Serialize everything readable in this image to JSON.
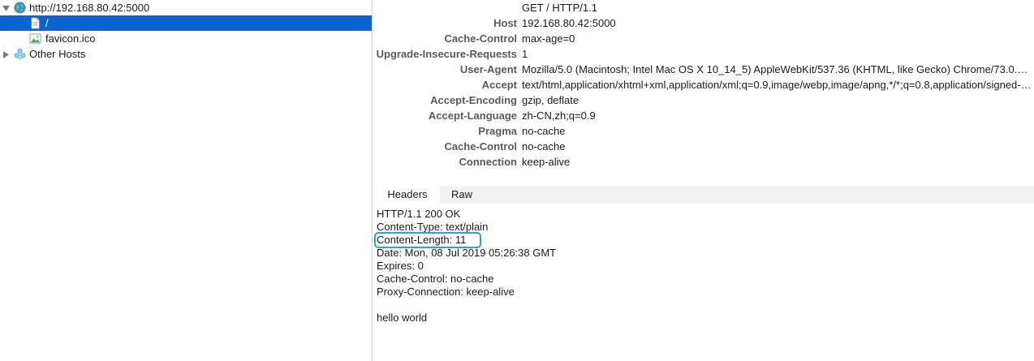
{
  "tree": {
    "host": {
      "label": "http://192.168.80.42:5000",
      "icon": "globe-icon",
      "expanded": true
    },
    "children": [
      {
        "label": "/",
        "icon": "document-icon",
        "selected": true
      },
      {
        "label": "favicon.ico",
        "icon": "image-icon",
        "selected": false
      }
    ],
    "other_hosts": {
      "label": "Other Hosts",
      "icon": "cluster-icon",
      "expanded": false
    }
  },
  "request": {
    "first_line": "GET / HTTP/1.1",
    "headers": [
      {
        "key": "Host",
        "value": "192.168.80.42:5000"
      },
      {
        "key": "Cache-Control",
        "value": "max-age=0"
      },
      {
        "key": "Upgrade-Insecure-Requests",
        "value": "1"
      },
      {
        "key": "User-Agent",
        "value": "Mozilla/5.0 (Macintosh; Intel Mac OS X 10_14_5) AppleWebKit/537.36 (KHTML, like Gecko) Chrome/73.0.36…"
      },
      {
        "key": "Accept",
        "value": "text/html,application/xhtml+xml,application/xml;q=0.9,image/webp,image/apng,*/*;q=0.8,application/signed-…"
      },
      {
        "key": "Accept-Encoding",
        "value": "gzip, deflate"
      },
      {
        "key": "Accept-Language",
        "value": "zh-CN,zh;q=0.9"
      },
      {
        "key": "Pragma",
        "value": "no-cache"
      },
      {
        "key": "Cache-Control",
        "value": "no-cache"
      },
      {
        "key": "Connection",
        "value": "keep-alive"
      }
    ]
  },
  "tabs": [
    {
      "label": "Headers",
      "active": true
    },
    {
      "label": "Raw",
      "active": false
    }
  ],
  "response": {
    "lines": [
      "HTTP/1.1 200 OK",
      "Content-Type: text/plain",
      "Content-Length: 11",
      "Date: Mon, 08 Jul 2019 05:26:38 GMT",
      "Expires: 0",
      "Cache-Control: no-cache",
      "Proxy-Connection: keep-alive"
    ],
    "highlighted_line": "Content-Length: 11",
    "highlight_color": "#29a3d8",
    "body": "hello world"
  },
  "colors": {
    "selection": "#0b64d6",
    "key_text": "#5a5a5a",
    "divider": "#d4d4d4"
  }
}
